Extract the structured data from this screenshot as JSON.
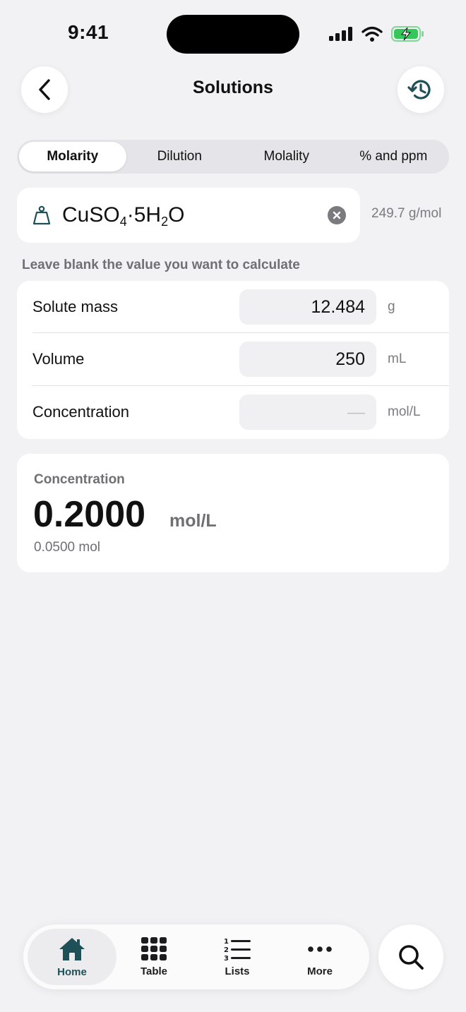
{
  "status_bar": {
    "time": "9:41"
  },
  "header": {
    "title": "Solutions"
  },
  "tabs": [
    {
      "label": "Molarity",
      "active": true
    },
    {
      "label": "Dilution",
      "active": false
    },
    {
      "label": "Molality",
      "active": false
    },
    {
      "label": "% and ppm",
      "active": false
    }
  ],
  "compound": {
    "formula_parts": {
      "a": "CuSO",
      "b": "4",
      "c": "·5H",
      "d": "2",
      "e": "O"
    },
    "molar_mass": "249.7 g/mol"
  },
  "hint": "Leave blank the value you want to calculate",
  "inputs": [
    {
      "label": "Solute mass",
      "value": "12.484",
      "unit": "g"
    },
    {
      "label": "Volume",
      "value": "250",
      "unit": "mL"
    },
    {
      "label": "Concentration",
      "value": "—",
      "unit": "mol/L"
    }
  ],
  "result": {
    "label": "Concentration",
    "value": "0.2000",
    "unit": "mol/L",
    "sub": "0.0500 mol"
  },
  "nav": [
    {
      "label": "Home",
      "icon": "home-icon",
      "active": true
    },
    {
      "label": "Table",
      "icon": "grid-icon",
      "active": false
    },
    {
      "label": "Lists",
      "icon": "numbered-list-icon",
      "active": false
    },
    {
      "label": "More",
      "icon": "more-dots-icon",
      "active": false
    }
  ],
  "colors": {
    "accent": "#1f4f57",
    "background": "#f2f2f5"
  }
}
